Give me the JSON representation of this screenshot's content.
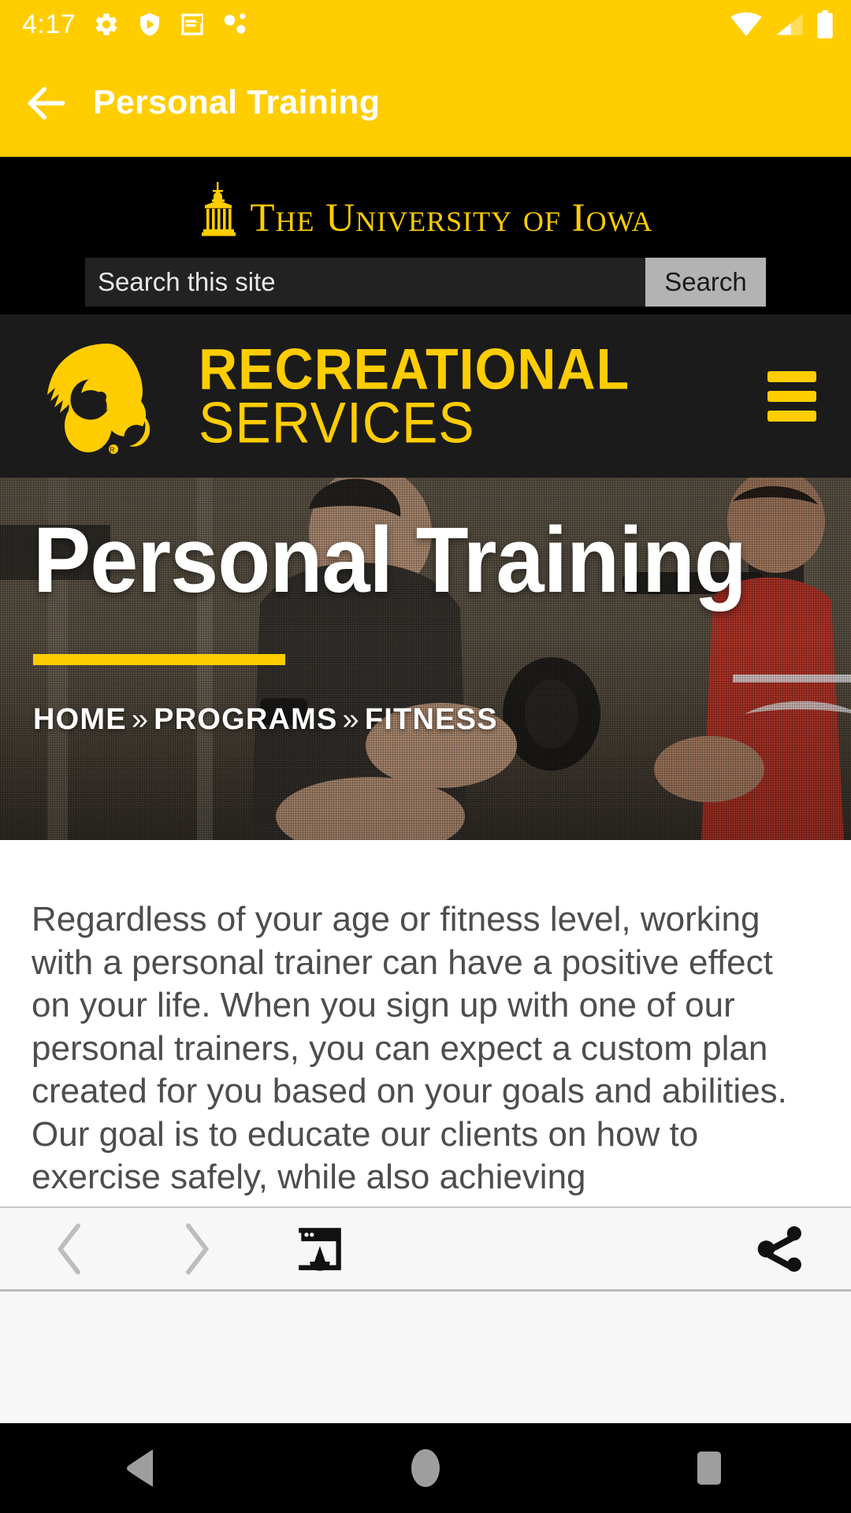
{
  "statusbar": {
    "time": "4:17",
    "left_icons": [
      "gear-icon",
      "play-protect-shield-icon",
      "message-icon",
      "assistant-dots-icon"
    ],
    "right_icons": [
      "wifi-icon",
      "cellular-signal-icon",
      "battery-icon"
    ],
    "background_color": "#ffcd00",
    "foreground_color": "#ffffff"
  },
  "appbar": {
    "back_icon": "back-arrow-icon",
    "title": "Personal Training",
    "background_color": "#ffcd00",
    "title_color": "#ffffff"
  },
  "site": {
    "masthead": {
      "logo_icon": "old-capitol-icon",
      "university_name": "The University of Iowa",
      "background_color": "#000000",
      "text_color": "#ffcd00"
    },
    "search": {
      "value": "",
      "placeholder": "Search this site",
      "button_label": "Search"
    },
    "nav": {
      "logo_icon": "tigerhawk-logo-icon",
      "wordmark_line1": "RECREATIONAL",
      "wordmark_line2": "SERVICES",
      "menu_icon": "hamburger-menu-icon",
      "background_color": "#1b1b1b",
      "accent_color": "#ffcd00"
    },
    "hero": {
      "title": "Personal Training",
      "rule_color": "#ffcd00",
      "breadcrumb": [
        {
          "label": "HOME",
          "sep": "»"
        },
        {
          "label": "PROGRAMS",
          "sep": "»"
        },
        {
          "label": "FITNESS",
          "sep": ""
        }
      ]
    },
    "article": {
      "paragraph": "Regardless of your age or fitness level, working with a personal trainer can have a positive effect on your life. When you sign up with one of our personal trainers, you can expect a custom plan created for you based on your goals and abilities. Our goal is to educate our clients on how to exercise safely, while also achieving"
    }
  },
  "toolbar": {
    "back_icon": "chevron-left-icon",
    "forward_icon": "chevron-right-icon",
    "open_in_browser_icon": "open-in-browser-icon",
    "share_icon": "share-icon",
    "background_color": "#f7f7f7"
  },
  "navbar": {
    "back_icon": "nav-back-triangle-icon",
    "home_icon": "nav-home-circle-icon",
    "recents_icon": "nav-recents-square-icon",
    "background_color": "#000000",
    "icon_color": "#9e9e9e"
  }
}
